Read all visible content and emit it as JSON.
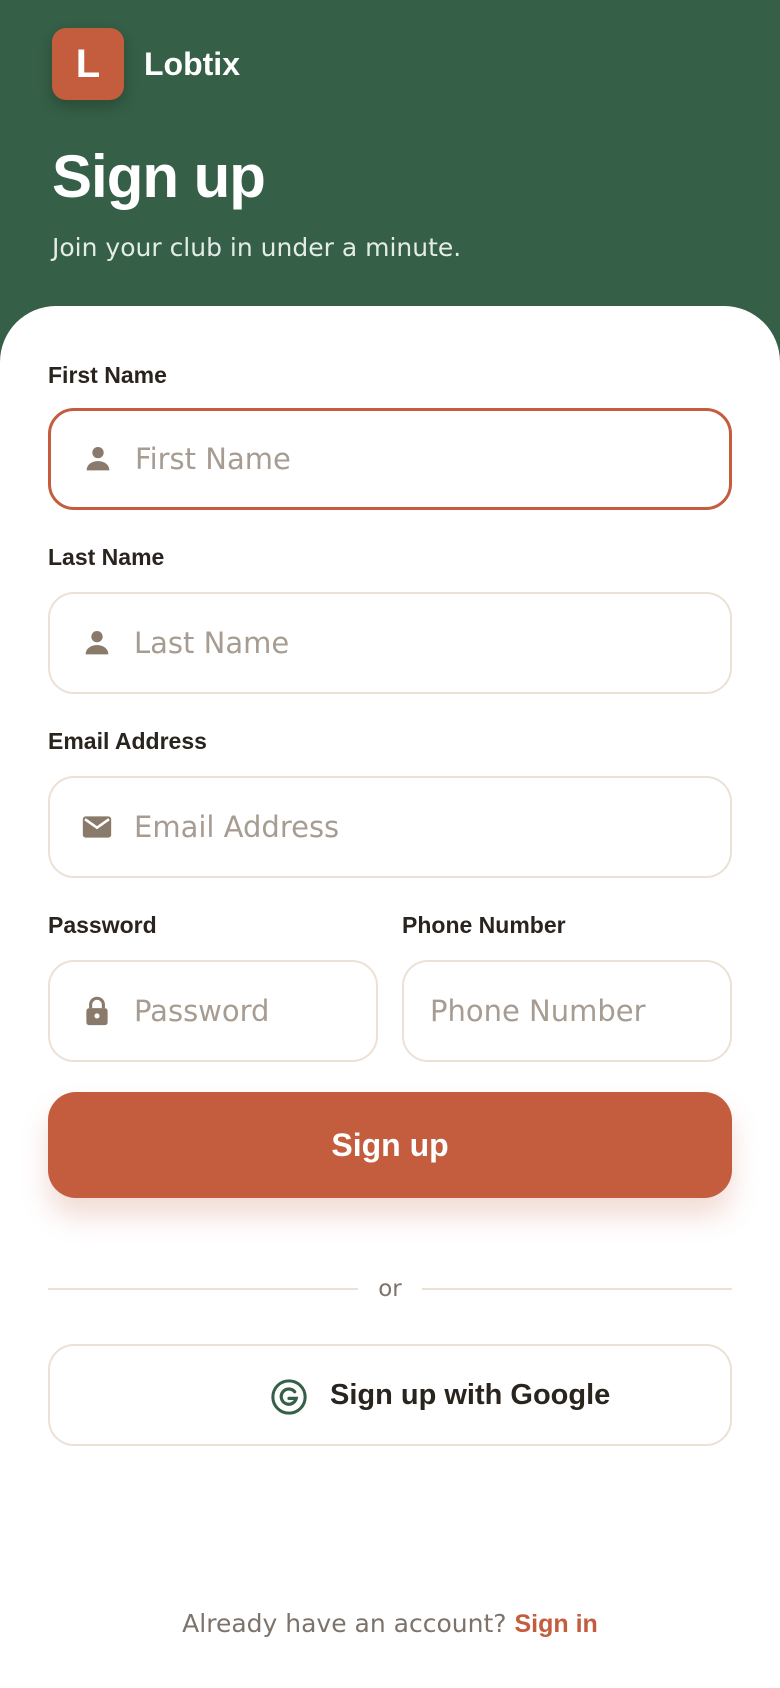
{
  "brand": {
    "logo_letter": "L",
    "name": "Lobtix"
  },
  "header": {
    "title": "Sign up",
    "subtitle": "Join your club in under a minute."
  },
  "form": {
    "first_name": {
      "label": "First Name",
      "placeholder": "First Name",
      "value": "",
      "icon": "person-icon",
      "focused": true
    },
    "last_name": {
      "label": "Last Name",
      "placeholder": "Last Name",
      "value": "",
      "icon": "person-icon"
    },
    "email": {
      "label": "Email Address",
      "placeholder": "Email Address",
      "value": "",
      "icon": "mail-icon"
    },
    "password": {
      "label": "Password",
      "placeholder": "Password",
      "value": "",
      "icon": "lock-icon"
    },
    "phone": {
      "label": "Phone Number",
      "placeholder": "Phone Number",
      "value": ""
    },
    "submit_label": "Sign up"
  },
  "divider": {
    "text": "or"
  },
  "google": {
    "label": "Sign up with Google",
    "icon": "google-g-icon"
  },
  "footer": {
    "prompt": "Already have an account?",
    "link": "Sign in"
  },
  "colors": {
    "header_green": "#355f46",
    "accent": "#c45c3e",
    "border": "#ebe1d5",
    "icon_muted": "#8a7a6b",
    "text_dark": "#2a241f"
  }
}
